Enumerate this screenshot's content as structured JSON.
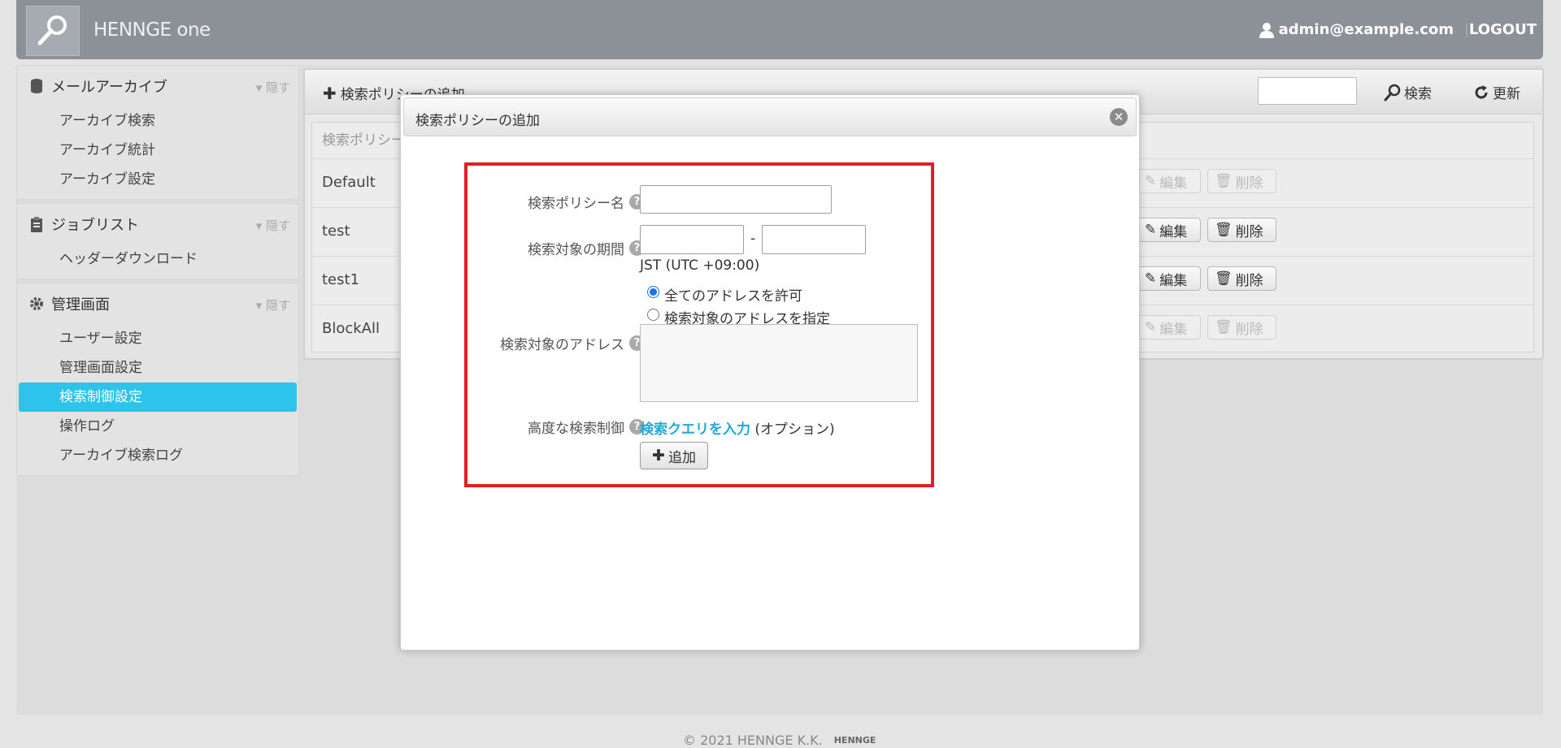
{
  "header": {
    "brand": "HENNGE one",
    "user_email": "admin@example.com",
    "separator": "|",
    "logout": "LOGOUT"
  },
  "sidebar": {
    "hide_label": "▾ 隠す",
    "sections": [
      {
        "title": "メールアーカイブ",
        "items": [
          "アーカイブ検索",
          "アーカイブ統計",
          "アーカイブ設定"
        ]
      },
      {
        "title": "ジョブリスト",
        "items": [
          "ヘッダーダウンロード"
        ]
      },
      {
        "title": "管理画面",
        "items": [
          "ユーザー設定",
          "管理画面設定",
          "検索制御設定",
          "操作ログ",
          "アーカイブ検索ログ"
        ]
      }
    ],
    "active_item": "検索制御設定"
  },
  "toolbar": {
    "add_policy": "検索ポリシーの追加",
    "search": "検索",
    "refresh": "更新"
  },
  "table": {
    "header": "検索ポリシー",
    "rows": [
      {
        "name": "Default",
        "edit": "編集",
        "delete": "削除",
        "enabled": false
      },
      {
        "name": "test",
        "edit": "編集",
        "delete": "削除",
        "enabled": true
      },
      {
        "name": "test1",
        "edit": "編集",
        "delete": "削除",
        "enabled": true
      },
      {
        "name": "BlockAll",
        "edit": "編集",
        "delete": "削除",
        "enabled": false
      }
    ]
  },
  "modal": {
    "title": "検索ポリシーの追加",
    "close": "✕",
    "policy_name_label": "検索ポリシー名",
    "policy_name_value": "",
    "period_label": "検索対象の期間",
    "period_from": "",
    "period_sep": "-",
    "period_to": "",
    "timezone": "JST (UTC +09:00)",
    "address_label": "検索対象のアドレス",
    "radio_all": "全てのアドレスを許可",
    "radio_specify": "検索対象のアドレスを指定",
    "radio_selected": "all",
    "advanced_label": "高度な検索制御",
    "query_link": "検索クエリを入力",
    "option_text": "(オプション)",
    "add_button": "追加",
    "help": "?"
  },
  "footer": {
    "copyright": "© 2021 HENNGE K.K.",
    "logo_text": "HENNGE"
  }
}
